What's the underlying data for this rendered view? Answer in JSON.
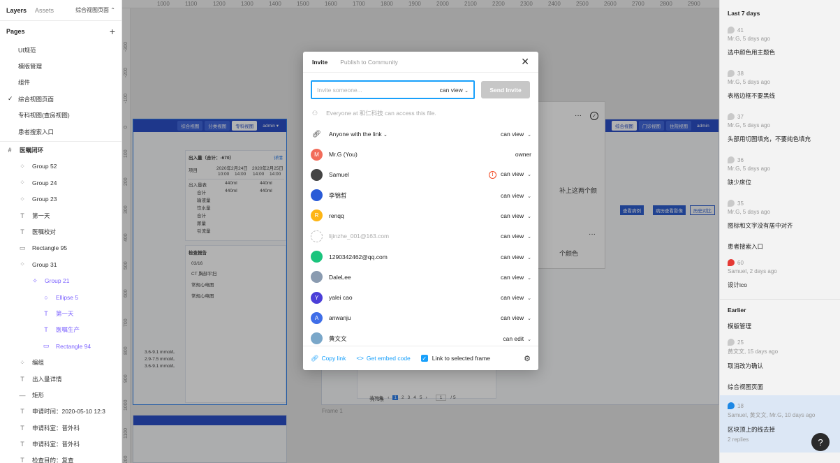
{
  "left": {
    "tabs": [
      "Layers",
      "Assets"
    ],
    "page_switch": "综合视图页面 ⌃",
    "pages_title": "Pages",
    "pages": [
      "UI规范",
      "模版管理",
      "组件",
      "综合视图页面",
      "专科视图(查房视图)",
      "患者搜索入口"
    ],
    "layers": [
      {
        "label": "医嘱闭环",
        "icon": "#"
      },
      {
        "label": "Group 52",
        "icon": "⁘"
      },
      {
        "label": "Group 24",
        "icon": "⁘"
      },
      {
        "label": "Group 23",
        "icon": "⁘"
      },
      {
        "label": "第一天",
        "icon": "T"
      },
      {
        "label": "医嘱校对",
        "icon": "T"
      },
      {
        "label": "Rectangle 95",
        "icon": "▭"
      },
      {
        "label": "Group 31",
        "icon": "⁘"
      },
      {
        "label": "Group 21",
        "icon": "✧"
      },
      {
        "label": "Ellipse 5",
        "icon": "○"
      },
      {
        "label": "第一天",
        "icon": "T"
      },
      {
        "label": "医嘱生产",
        "icon": "T"
      },
      {
        "label": "Rectangle 94",
        "icon": "▭"
      },
      {
        "label": "编组",
        "icon": "⁘"
      },
      {
        "label": "出入量详情",
        "icon": "T"
      },
      {
        "label": "矩形",
        "icon": "—"
      },
      {
        "label": "申请时间：2020-05-10 12:3",
        "icon": "T"
      },
      {
        "label": "申请科室：普外科",
        "icon": "T"
      },
      {
        "label": "申请科室：普外科",
        "icon": "T"
      },
      {
        "label": "检查目的：复查",
        "icon": "T"
      }
    ]
  },
  "ruler": {
    "top": [
      "1000",
      "1100",
      "1200",
      "1300",
      "1400",
      "1500",
      "1600",
      "1700",
      "1800",
      "1900",
      "2000",
      "2100",
      "2200",
      "2300",
      "2400",
      "2500",
      "2600",
      "2700",
      "2800",
      "2900"
    ],
    "left": [
      "-300",
      "-200",
      "-100",
      "0",
      "100",
      "200",
      "300",
      "400",
      "500",
      "600",
      "700",
      "800",
      "900",
      "1000",
      "1100",
      "1200"
    ]
  },
  "canvas": {
    "appbar_left": [
      "综合视图",
      "分类视图",
      "专科视图",
      "admin ▾"
    ],
    "appbar_right": [
      "综合视图",
      "门诊视图",
      "住院视图",
      "admin"
    ],
    "table_title": "出入量（合计：-670）",
    "table_label": "详情",
    "table_cols": [
      "项目",
      "2020年2月24日",
      "2020年2月25日"
    ],
    "table_times": [
      "10:00",
      "14:00",
      "14:00",
      "14:00"
    ],
    "table_rows": [
      {
        "name": "出入量表",
        "a": "440ml",
        "b": "440ml"
      },
      {
        "name": "合计",
        "a": "440ml",
        "b": "440ml"
      },
      {
        "name": "输液量",
        "a": "",
        "b": ""
      },
      {
        "name": "饮水量",
        "a": "",
        "b": ""
      },
      {
        "name": "合计",
        "a": "",
        "b": ""
      },
      {
        "name": "尿量",
        "a": "",
        "b": ""
      },
      {
        "name": "引流量",
        "a": "",
        "b": ""
      }
    ],
    "report_title": "检查报告",
    "report_items": [
      "CT 胸部平扫",
      "常规心电图",
      "常规心电图"
    ],
    "report_date": "03/16",
    "frame_label": "Frame 1",
    "pager": {
      "total": "共75条",
      "pages": [
        "1",
        "2",
        "3",
        "4",
        "5"
      ],
      "input": "1",
      "of": "/ 5"
    },
    "side_snippets": [
      "补上这两个颜",
      "个颜色"
    ],
    "right_buttons": [
      "查看病例",
      "病历查看影像",
      "历史对比"
    ],
    "labs": [
      "3.6-9.1 mmol/L",
      "2.9-7.5 mmol/L",
      "3.6-9.1 mmol/L"
    ]
  },
  "dialog": {
    "tabs": [
      "Invite",
      "Publish to Community"
    ],
    "invite_placeholder": "Invite someone...",
    "invite_perm": "can view",
    "send_label": "Send Invite",
    "everyone_text": "Everyone at 和仁科技 can access this file.",
    "link_label": "Anyone with the link",
    "link_perm": "can view",
    "people": [
      {
        "name": "Mr.G (You)",
        "perm": "owner",
        "initial": "M",
        "color": "#f26c5a",
        "warn": false,
        "chev": false
      },
      {
        "name": "Samuel",
        "perm": "can view",
        "initial": "",
        "color": "#444444",
        "warn": true,
        "chev": true
      },
      {
        "name": "李锦哲",
        "perm": "can view",
        "initial": "",
        "color": "#2a5bd7",
        "warn": false,
        "chev": true
      },
      {
        "name": "renqq",
        "perm": "can view",
        "initial": "R",
        "color": "#fdb515",
        "warn": false,
        "chev": true
      },
      {
        "name": "lijinzhe_001@163.com",
        "perm": "can view",
        "initial": "",
        "color": "#ffffff",
        "warn": false,
        "chev": true,
        "pending": true
      },
      {
        "name": "1290342462@qq.com",
        "perm": "can view",
        "initial": "",
        "color": "#1bc47d",
        "warn": false,
        "chev": true
      },
      {
        "name": "DaleLee",
        "perm": "can view",
        "initial": "",
        "color": "#8a9bb0",
        "warn": false,
        "chev": true
      },
      {
        "name": "yalei cao",
        "perm": "can view",
        "initial": "Y",
        "color": "#4b3fd8",
        "warn": false,
        "chev": true
      },
      {
        "name": "anwanju",
        "perm": "can view",
        "initial": "A",
        "color": "#3f6ee8",
        "warn": false,
        "chev": true
      },
      {
        "name": "黄文文",
        "perm": "can edit",
        "initial": "",
        "color": "#7aa7c9",
        "warn": false,
        "chev": true
      }
    ],
    "copy_link": "Copy link",
    "embed": "Get embed code",
    "link_frame": "Link to selected frame"
  },
  "right": {
    "head": "Last 7 days",
    "comments": [
      {
        "num": "41",
        "meta": "Mr.G, 5 days ago",
        "msg": "选中颜色用主题色",
        "color": "gray"
      },
      {
        "num": "38",
        "meta": "Mr.G, 5 days ago",
        "msg": "表格边框不要黑线",
        "color": "gray"
      },
      {
        "num": "37",
        "meta": "Mr.G, 5 days ago",
        "msg": "头部用切图填充，不要纯色填充",
        "color": "gray"
      },
      {
        "num": "36",
        "meta": "Mr.G, 5 days ago",
        "msg": "缺少床位",
        "color": "gray"
      },
      {
        "num": "35",
        "meta": "Mr.G, 5 days ago",
        "msg": "图标和文字没有居中对齐",
        "color": "gray"
      }
    ],
    "section1": "患者搜索入口",
    "comment60": {
      "num": "60",
      "meta": "Samuel, 2 days ago",
      "msg": "设计ico",
      "color": "red"
    },
    "earlier": "Earlier",
    "section2": "模版管理",
    "comment25": {
      "num": "25",
      "meta": "黄文文, 15 days ago",
      "msg": "取消改为确认",
      "color": "gray"
    },
    "section3": "综合视图页面",
    "comment18": {
      "num": "18",
      "meta": "Samuel, 黄文文, Mr.G, 10 days ago",
      "msg": "区块顶上的线去掉",
      "replies": "2 replies",
      "color": "blue"
    },
    "help": "?"
  }
}
